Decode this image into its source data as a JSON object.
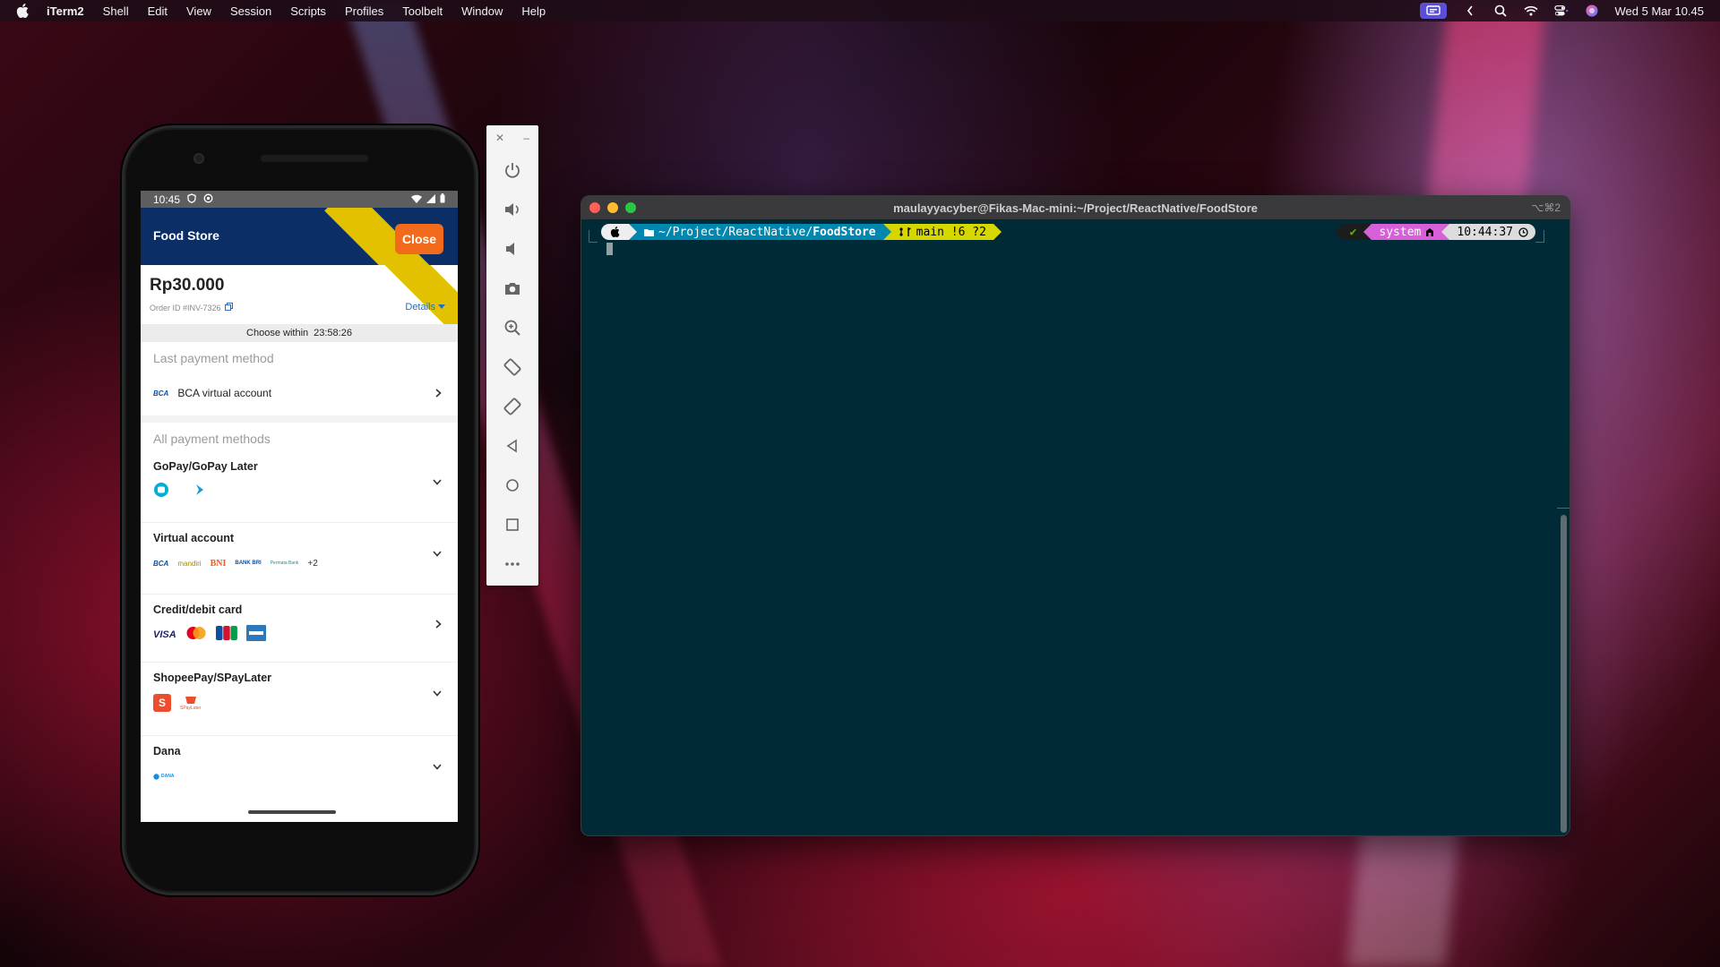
{
  "menubar": {
    "app_name": "iTerm2",
    "items": [
      "Shell",
      "Edit",
      "View",
      "Session",
      "Scripts",
      "Profiles",
      "Toolbelt",
      "Window",
      "Help"
    ],
    "clock": "Wed 5 Mar  10.45"
  },
  "phone": {
    "status_time": "10:45",
    "app_title": "Food Store",
    "close_label": "Close",
    "amount": "Rp30.000",
    "order_id": "Order ID #INV-7326",
    "details_label": "Details",
    "countdown_label": "Choose within",
    "countdown_value": "23:58:26",
    "last_method_heading": "Last payment method",
    "last_method": {
      "logo": "BCA",
      "label": "BCA virtual account"
    },
    "all_methods_heading": "All payment methods",
    "groups": [
      {
        "title": "GoPay/GoPay Later"
      },
      {
        "title": "Virtual account",
        "logos": [
          "BCA",
          "mandiri",
          "BNI",
          "BANK BRI",
          "Permata Bank"
        ],
        "more": "+2"
      },
      {
        "title": "Credit/debit card",
        "logos": [
          "VISA"
        ]
      },
      {
        "title": "ShopeePay/SPayLater",
        "logos": [
          "S",
          "SPayLater"
        ]
      },
      {
        "title": "Dana",
        "logos": [
          "DANA"
        ]
      }
    ]
  },
  "terminal": {
    "title": "maulayyacyber@Fikas-Mac-mini:~/Project/ReactNative/FoodStore",
    "shortcut": "⌥⌘2",
    "prompt": {
      "dir_prefix": "~/Project/ReactNative/",
      "dir_current": "FoodStore",
      "git": "main !6 ?2",
      "status_ok": "✔",
      "env": "system",
      "time": "10:44:37"
    }
  },
  "colors": {
    "terminal_bg": "#002b36",
    "appbar_bg": "#0b2e66",
    "accent_orange": "#f26a1b",
    "accent_yellow": "#e2c200",
    "link_blue": "#1f6fc5"
  }
}
